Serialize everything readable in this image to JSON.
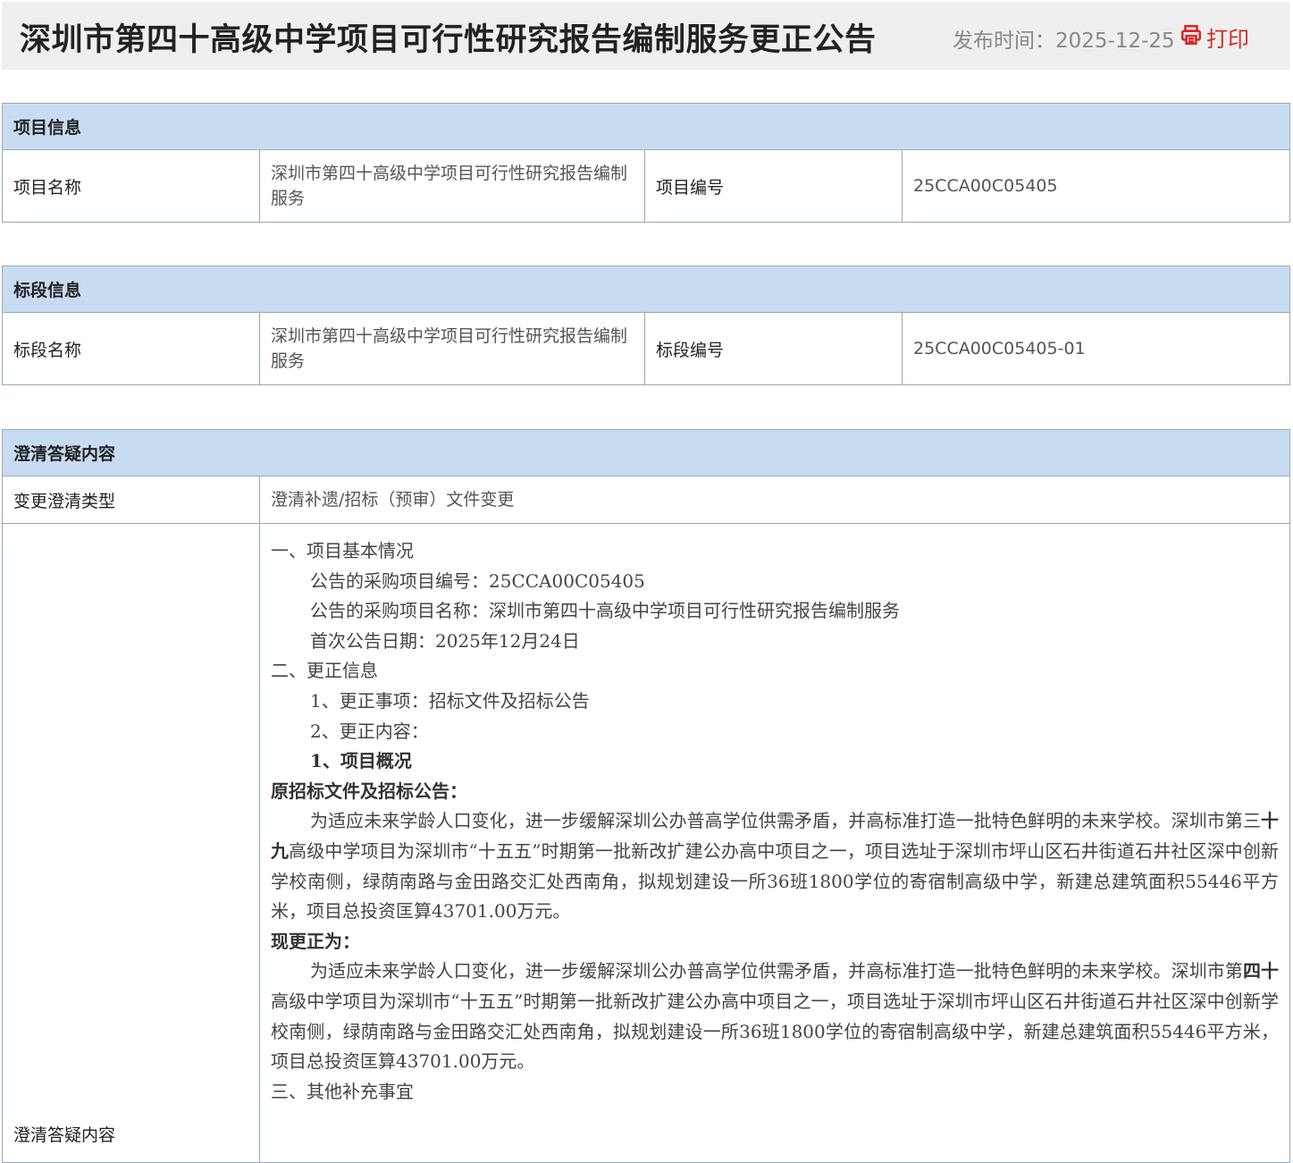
{
  "header": {
    "title": "深圳市第四十高级中学项目可行性研究报告编制服务更正公告",
    "publish_time": "发布时间：2025-12-25",
    "print_label": "打印",
    "accent_color": "#d42b2b"
  },
  "project_info": {
    "section_title": "项目信息",
    "name_label": "项目名称",
    "name_value": "深圳市第四十高级中学项目可行性研究报告编制服务",
    "code_label": "项目编号",
    "code_value": "25CCA00C05405"
  },
  "section_info": {
    "section_title": "标段信息",
    "name_label": "标段名称",
    "name_value": "深圳市第四十高级中学项目可行性研究报告编制服务",
    "code_label": "标段编号",
    "code_value": "25CCA00C05405-01"
  },
  "clarification": {
    "section_title": "澄清答疑内容",
    "type_label": "变更澄清类型",
    "type_value": "澄清补遗/招标（预审）文件变更",
    "content_label": "澄清答疑内容",
    "lines": {
      "l1": "一、项目基本情况",
      "l2": "公告的采购项目编号：25CCA00C05405",
      "l3": "公告的采购项目名称：深圳市第四十高级中学项目可行性研究报告编制服务",
      "l4": "首次公告日期：2025年12月24日",
      "l5": "二、更正信息",
      "l6": "1、更正事项：招标文件及招标公告",
      "l7": "2、更正内容：",
      "l8": "1、项目概况",
      "l9": "原招标文件及招标公告：",
      "l10a": "为适应未来学龄人口变化，进一步缓解深圳公办普高学位供需矛盾，并高标准打造一批特色鲜明的未来学校。深圳市第三",
      "l10b": "十九",
      "l10c": "高级中学项目为深圳市“十五五”时期第一批新改扩建公办高中项目之一，项目选址于深圳市坪山区石井街道石井社区深中创新学校南侧，绿荫南路与金田路交汇处西南角，拟规划建设一所36班1800学位的寄宿制高级中学，新建总建筑面积55446平方米，项目总投资匡算43701.00万元。",
      "l11": "现更正为：",
      "l12a": "为适应未来学龄人口变化，进一步缓解深圳公办普高学位供需矛盾，并高标准打造一批特色鲜明的未来学校。深圳市第",
      "l12b": "四十",
      "l12c": "高级中学项目为深圳市“十五五”时期第一批新改扩建公办高中项目之一，项目选址于深圳市坪山区石井街道石井社区深中创新学校南侧，绿荫南路与金田路交汇处西南角，拟规划建设一所36班1800学位的寄宿制高级中学，新建总建筑面积55446平方米，项目总投资匡算43701.00万元。",
      "l13": "三、其他补充事宜"
    }
  }
}
